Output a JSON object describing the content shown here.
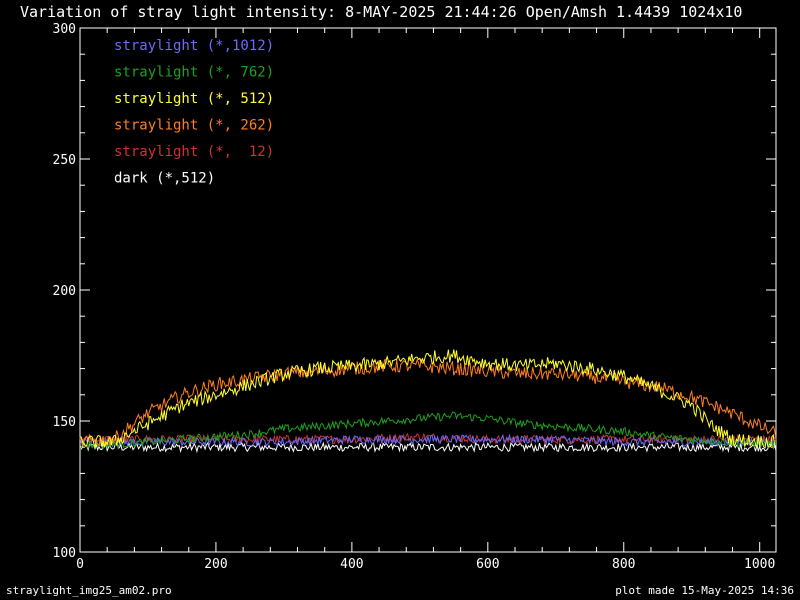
{
  "footer": {
    "left": "straylight_img25_am02.pro",
    "right": "plot made 15-May-2025 14:36"
  },
  "chart_data": {
    "type": "line",
    "title": "Variation of stray light intensity:  8-MAY-2025 21:44:26   Open/Amsh   1.4439 1024x10",
    "xlabel": "",
    "ylabel": "",
    "xlim": [
      0,
      1024
    ],
    "ylim": [
      100,
      300
    ],
    "xticks": [
      0,
      200,
      400,
      600,
      800,
      1000
    ],
    "yticks": [
      100,
      150,
      200,
      250,
      300
    ],
    "grid": false,
    "legend_position": "top-left",
    "series": [
      {
        "name": "straylight (*,1012)",
        "color": "#6a6aff",
        "x": [
          0,
          100,
          200,
          300,
          400,
          500,
          600,
          700,
          800,
          900,
          1024
        ],
        "y": [
          142,
          142,
          142,
          142,
          143,
          143,
          143,
          143,
          142,
          142,
          142
        ]
      },
      {
        "name": "straylight (*, 762)",
        "color": "#1fa01f",
        "x": [
          0,
          50,
          100,
          150,
          200,
          250,
          300,
          350,
          400,
          450,
          500,
          550,
          600,
          650,
          700,
          750,
          800,
          850,
          900,
          950,
          1024
        ],
        "y": [
          141,
          141,
          142,
          143,
          144,
          145,
          147,
          148,
          149,
          150,
          151,
          152,
          151,
          149,
          148,
          147,
          146,
          144,
          143,
          142,
          141
        ]
      },
      {
        "name": "straylight (*, 512)",
        "color": "#ffff30",
        "x": [
          0,
          50,
          100,
          150,
          200,
          250,
          300,
          350,
          400,
          450,
          500,
          550,
          600,
          650,
          700,
          750,
          800,
          850,
          900,
          930,
          960,
          1024
        ],
        "y": [
          142,
          142,
          149,
          156,
          160,
          164,
          168,
          170,
          171,
          172,
          174,
          175,
          172,
          171,
          172,
          170,
          167,
          162,
          156,
          148,
          143,
          142
        ]
      },
      {
        "name": "straylight (*, 262)",
        "color": "#ff7f1f",
        "x": [
          0,
          50,
          100,
          150,
          200,
          250,
          300,
          350,
          400,
          450,
          500,
          550,
          600,
          650,
          700,
          750,
          800,
          850,
          900,
          950,
          1000,
          1024
        ],
        "y": [
          142,
          143,
          153,
          160,
          164,
          166,
          168,
          169,
          170,
          171,
          171,
          170,
          169,
          168,
          168,
          167,
          165,
          163,
          159,
          154,
          148,
          145
        ]
      },
      {
        "name": "straylight (*,  12)",
        "color": "#cc3333",
        "x": [
          0,
          100,
          200,
          300,
          400,
          500,
          600,
          700,
          800,
          900,
          1024
        ],
        "y": [
          143,
          143,
          143,
          143,
          143,
          144,
          143,
          143,
          143,
          143,
          143
        ]
      },
      {
        "name": "dark (*,512)",
        "color": "#ffffff",
        "x": [
          0,
          100,
          200,
          300,
          400,
          500,
          600,
          700,
          800,
          900,
          1024
        ],
        "y": [
          140,
          140,
          140,
          140,
          140,
          140,
          140,
          140,
          140,
          140,
          140
        ]
      }
    ]
  }
}
